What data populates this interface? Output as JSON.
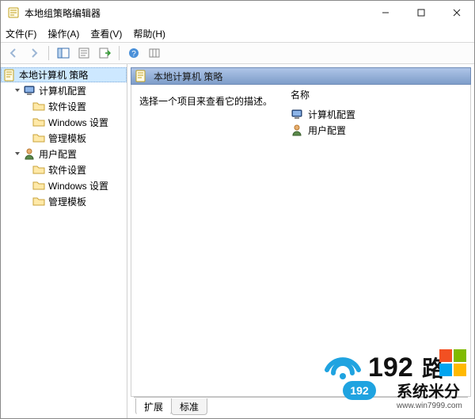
{
  "window": {
    "title": "本地组策略编辑器"
  },
  "menu": {
    "file": "文件(F)",
    "action": "操作(A)",
    "view": "查看(V)",
    "help": "帮助(H)"
  },
  "tree": {
    "root": "本地计算机 策略",
    "computer": "计算机配置",
    "user": "用户配置",
    "software": "软件设置",
    "windows": "Windows 设置",
    "admin": "管理模板"
  },
  "content": {
    "header": "本地计算机 策略",
    "description": "选择一个项目来查看它的描述。",
    "column_name": "名称",
    "rows": {
      "computer": "计算机配置",
      "user": "用户配置"
    }
  },
  "tabs": {
    "extended": "扩展",
    "standard": "标准"
  },
  "watermark": {
    "big_num": "192",
    "badge_num": "192",
    "suffix": "路",
    "brand": "系统米分",
    "url_hint": "www.win7999.com"
  }
}
